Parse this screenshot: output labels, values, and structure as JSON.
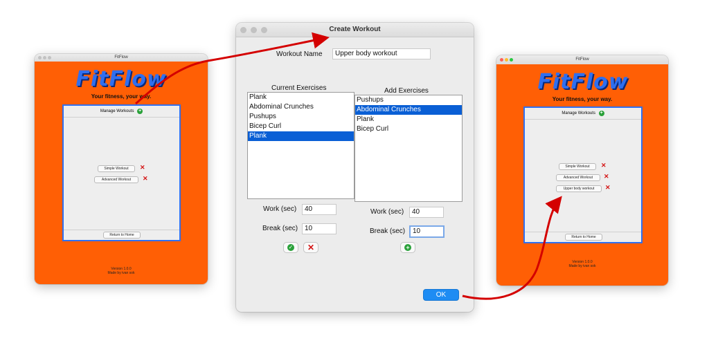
{
  "left_window": {
    "title": "FitFlow",
    "logo": "FitFlow",
    "tagline": "Your fitness, your way.",
    "manage_label": "Manage Workouts",
    "workouts": [
      "Simple Workout",
      "Advanced Workout"
    ],
    "return_label": "Return to Home",
    "version": "Version 1.0.0",
    "made_by": "Made by ivan sok"
  },
  "dialog": {
    "title": "Create Workout",
    "name_label": "Workout Name",
    "name_value": "Upper body workout",
    "current_header": "Current Exercises",
    "current_items": [
      "Plank",
      "Abdominal Crunches",
      "Pushups",
      "Bicep Curl",
      "Plank"
    ],
    "current_selected_index": 4,
    "add_header": "Add Exercises",
    "add_items": [
      "Pushups",
      "Abdominal Crunches",
      "Plank",
      "Bicep Curl"
    ],
    "add_selected_index": 1,
    "left_work_label": "Work (sec)",
    "left_work_value": "40",
    "left_break_label": "Break (sec)",
    "left_break_value": "10",
    "right_work_label": "Work (sec)",
    "right_work_value": "40",
    "right_break_label": "Break (sec)",
    "right_break_value": "10",
    "ok_label": "OK"
  },
  "right_window": {
    "title": "FitFlow",
    "logo": "FitFlow",
    "tagline": "Your fitness, your way.",
    "manage_label": "Manage Workouts",
    "workouts": [
      "Simple Workout",
      "Advanced Workout",
      "Upper body workout"
    ],
    "return_label": "Return to Home",
    "version": "Version 1.0.0",
    "made_by": "Made by ivan sok"
  },
  "colors": {
    "brand_orange": "#ff5f05",
    "logo_blue": "#2f6ff0",
    "selection_blue": "#0a5fd5",
    "annotation_red": "#d40000"
  }
}
